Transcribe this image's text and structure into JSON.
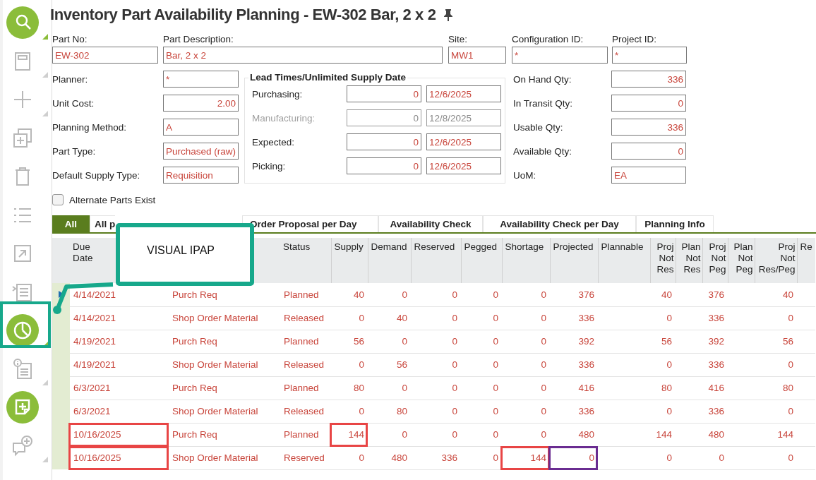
{
  "sidebar": {
    "items": [
      {
        "kind": "search",
        "has_menu": true,
        "highlighted": false
      },
      {
        "kind": "save",
        "has_menu": true,
        "highlighted": false
      },
      {
        "kind": "add",
        "has_menu": true,
        "highlighted": false
      },
      {
        "kind": "duplicate",
        "has_menu": false,
        "highlighted": false
      },
      {
        "kind": "delete",
        "has_menu": false,
        "highlighted": false
      },
      {
        "kind": "list",
        "has_menu": false,
        "highlighted": false
      },
      {
        "kind": "export",
        "has_menu": false,
        "highlighted": false
      },
      {
        "kind": "indent",
        "has_menu": false,
        "highlighted": false
      },
      {
        "kind": "chart",
        "has_menu": true,
        "highlighted": true
      },
      {
        "kind": "info",
        "has_menu": true,
        "highlighted": false
      },
      {
        "kind": "note",
        "has_menu": false,
        "highlighted": false
      },
      {
        "kind": "comment",
        "has_menu": true,
        "highlighted": false
      }
    ]
  },
  "title": "Inventory Part Availability Planning - EW-302 Bar, 2 x 2",
  "header_fields": [
    {
      "label": "Part No:",
      "value": "EW-302"
    },
    {
      "label": "Part Description:",
      "value": "Bar, 2 x 2"
    },
    {
      "label": "Site:",
      "value": "MW1"
    },
    {
      "label": "Configuration ID:",
      "value": "*"
    },
    {
      "label": "Project ID:",
      "value": "*"
    }
  ],
  "left_fields": [
    {
      "label": "Planner:",
      "value": "*"
    },
    {
      "label": "Unit Cost:",
      "value": "2.00"
    },
    {
      "label": "Planning Method:",
      "value": "A"
    },
    {
      "label": "Part Type:",
      "value": "Purchased (raw)"
    },
    {
      "label": "Default Supply Type:",
      "value": "Requisition"
    }
  ],
  "lead_times": {
    "title": "Lead Times/Unlimited Supply Date",
    "rows": [
      {
        "label": "Purchasing:",
        "days": "0",
        "date": "12/6/2025",
        "disabled": false
      },
      {
        "label": "Manufacturing:",
        "days": "0",
        "date": "12/8/2025",
        "disabled": true
      },
      {
        "label": "Expected:",
        "days": "0",
        "date": "12/6/2025",
        "disabled": false
      },
      {
        "label": "Picking:",
        "days": "0",
        "date": "12/6/2025",
        "disabled": false
      }
    ]
  },
  "right_fields": [
    {
      "label": "On Hand Qty:",
      "value": "336"
    },
    {
      "label": "In Transit Qty:",
      "value": "0"
    },
    {
      "label": "Usable Qty:",
      "value": "336"
    },
    {
      "label": "Available Qty:",
      "value": "0"
    },
    {
      "label": "UoM:",
      "value": "EA"
    }
  ],
  "alternate_parts": {
    "label": "Alternate Parts Exist",
    "checked": false
  },
  "tabs": [
    {
      "label": "All",
      "selected": true
    },
    {
      "label": "All p",
      "selected": false
    },
    {
      "label": "Order Proposal per Day",
      "selected": false
    },
    {
      "label": "Availability Check",
      "selected": false
    },
    {
      "label": "Availability Check per Day",
      "selected": false
    },
    {
      "label": "Planning Info",
      "selected": false
    }
  ],
  "table": {
    "columns": [
      {
        "label": "Due\nDate",
        "kind": "text"
      },
      {
        "kind": "text"
      },
      {
        "label": "Status",
        "kind": "text"
      },
      {
        "label": "Supply",
        "kind": "number"
      },
      {
        "label": "Demand",
        "kind": "number"
      },
      {
        "label": "Reserved",
        "kind": "number"
      },
      {
        "label": "Pegged",
        "kind": "number"
      },
      {
        "label": "Shortage",
        "kind": "number"
      },
      {
        "label": "Projected",
        "kind": "number"
      },
      {
        "label": "Plannable",
        "kind": "number"
      },
      {
        "label": "Proj\nNot\nRes",
        "kind": "number"
      },
      {
        "label": "Plan\nNot\nRes",
        "kind": "number"
      },
      {
        "label": "Proj\nNot\nPeg",
        "kind": "number"
      },
      {
        "label": "Plan\nNot\nPeg",
        "kind": "number"
      },
      {
        "label": "Proj\nNot\nRes/Peg",
        "kind": "number"
      },
      {
        "label": "Re",
        "kind": "number"
      }
    ],
    "rows": [
      {
        "selected": true,
        "cells": [
          {
            "text": "4/14/2021"
          },
          {
            "text": "Purch Req"
          },
          {
            "text": "Planned"
          },
          {
            "text": "40"
          },
          {
            "text": "0"
          },
          {
            "text": "0"
          },
          {
            "text": "0"
          },
          {
            "text": "0"
          },
          {
            "text": "376"
          },
          {},
          {
            "text": "40"
          },
          {},
          {
            "text": "376"
          },
          {},
          {
            "text": "40"
          }
        ]
      },
      {
        "selected": false,
        "cells": [
          {
            "text": "4/14/2021"
          },
          {
            "text": "Shop Order Material"
          },
          {
            "text": "Released"
          },
          {
            "text": "0"
          },
          {
            "text": "40"
          },
          {
            "text": "0"
          },
          {
            "text": "0"
          },
          {
            "text": "0"
          },
          {
            "text": "336"
          },
          {},
          {
            "text": "0"
          },
          {},
          {
            "text": "336"
          },
          {},
          {
            "text": "0"
          }
        ]
      },
      {
        "selected": false,
        "cells": [
          {
            "text": "4/19/2021"
          },
          {
            "text": "Purch Req"
          },
          {
            "text": "Planned"
          },
          {
            "text": "56"
          },
          {
            "text": "0"
          },
          {
            "text": "0"
          },
          {
            "text": "0"
          },
          {
            "text": "0"
          },
          {
            "text": "392"
          },
          {},
          {
            "text": "56"
          },
          {},
          {
            "text": "392"
          },
          {},
          {
            "text": "56"
          }
        ]
      },
      {
        "selected": false,
        "cells": [
          {
            "text": "4/19/2021"
          },
          {
            "text": "Shop Order Material"
          },
          {
            "text": "Released"
          },
          {
            "text": "0"
          },
          {
            "text": "56"
          },
          {
            "text": "0"
          },
          {
            "text": "0"
          },
          {
            "text": "0"
          },
          {
            "text": "336"
          },
          {},
          {
            "text": "0"
          },
          {},
          {
            "text": "336"
          },
          {},
          {
            "text": "0"
          }
        ]
      },
      {
        "selected": false,
        "cells": [
          {
            "text": "6/3/2021"
          },
          {
            "text": "Purch Req"
          },
          {
            "text": "Planned"
          },
          {
            "text": "80"
          },
          {
            "text": "0"
          },
          {
            "text": "0"
          },
          {
            "text": "0"
          },
          {
            "text": "0"
          },
          {
            "text": "416"
          },
          {},
          {
            "text": "80"
          },
          {},
          {
            "text": "416"
          },
          {},
          {
            "text": "80"
          }
        ]
      },
      {
        "selected": false,
        "cells": [
          {
            "text": "6/3/2021"
          },
          {
            "text": "Shop Order Material"
          },
          {
            "text": "Released"
          },
          {
            "text": "0"
          },
          {
            "text": "80"
          },
          {
            "text": "0"
          },
          {
            "text": "0"
          },
          {
            "text": "0"
          },
          {
            "text": "336"
          },
          {},
          {
            "text": "0"
          },
          {},
          {
            "text": "336"
          },
          {},
          {
            "text": "0"
          }
        ]
      },
      {
        "selected": false,
        "cells": [
          {
            "text": "10/16/2025",
            "color": "#e84545"
          },
          {
            "text": "Purch Req"
          },
          {
            "text": "Planned"
          },
          {
            "text": "144",
            "color": "#e84545"
          },
          {
            "text": "0"
          },
          {
            "text": "0"
          },
          {
            "text": "0"
          },
          {
            "text": "0"
          },
          {
            "text": "480"
          },
          {},
          {
            "text": "144"
          },
          {},
          {
            "text": "480"
          },
          {},
          {
            "text": "144"
          }
        ]
      },
      {
        "selected": false,
        "cells": [
          {
            "text": "10/16/2025",
            "color": "#e84545"
          },
          {
            "text": "Shop Order Material"
          },
          {
            "text": "Reserved"
          },
          {
            "text": "0"
          },
          {
            "text": "480"
          },
          {
            "text": "336"
          },
          {
            "text": "0"
          },
          {
            "text": "144",
            "color": "#e84545"
          },
          {
            "text": "0",
            "color": "#6a2c91"
          },
          {},
          {
            "text": "0"
          },
          {},
          {
            "text": "0"
          },
          {},
          {
            "text": "0"
          }
        ]
      }
    ]
  },
  "callout": {
    "text": "VISUAL IPAP"
  }
}
